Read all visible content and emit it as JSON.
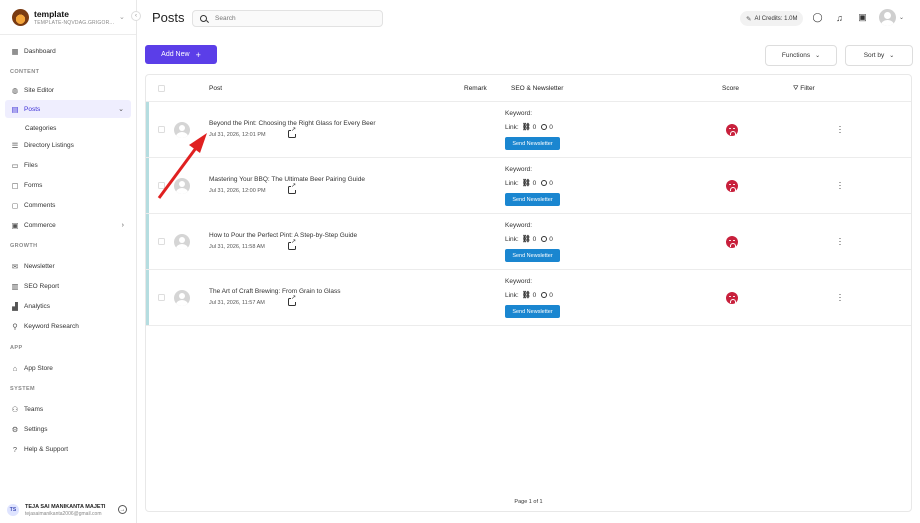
{
  "workspace": {
    "name": "template",
    "slug": "TEMPLATE-NQVDAG.GRIGOR...",
    "caret": "⌄"
  },
  "sidebar": {
    "collapse_glyph": "‹",
    "dashboard": "Dashboard",
    "content_label": "CONTENT",
    "site_editor": "Site Editor",
    "posts": "Posts",
    "categories": "Categories",
    "directory": "Directory Listings",
    "files": "Files",
    "forms": "Forms",
    "comments": "Comments",
    "commerce": "Commerce",
    "growth_label": "GROWTH",
    "newsletter": "Newsletter",
    "seo_report": "SEO Report",
    "analytics": "Analytics",
    "keyword_research": "Keyword Research",
    "app_label": "APP",
    "app_store": "App Store",
    "system_label": "SYSTEM",
    "teams": "Teams",
    "settings": "Settings",
    "help": "Help & Support",
    "chevron_down": "⌄",
    "chevron_right": "›"
  },
  "user": {
    "initials": "TS",
    "name": "TEJA SAI MANIKANTA MAJETI",
    "email": "tejasaimanikanta2006@gmail.com"
  },
  "header": {
    "title": "Posts",
    "search_placeholder": "Search",
    "credits": "AI Credits: 1.0M",
    "caret": "⌄"
  },
  "toolbar": {
    "add_new": "Add New",
    "add_plus": "+",
    "functions": "Functions",
    "sort_by": "Sort by",
    "caret": "⌄"
  },
  "table": {
    "columns": {
      "post": "Post",
      "remark": "Remark",
      "seo": "SEO & Newsletter",
      "score": "Score",
      "filter": "Filter"
    },
    "filter_glyph": "⛛",
    "keyword_label": "Keyword:",
    "link_label": "Link:",
    "send_label": "Send Newsletter",
    "rows": [
      {
        "title": "Beyond the Pint: Choosing the Right Glass for Every Beer",
        "date": "Jul 31, 2026, 12:01 PM",
        "links": "0",
        "time": "0"
      },
      {
        "title": "Mastering Your BBQ: The Ultimate Beer Pairing Guide",
        "date": "Jul 31, 2026, 12:00 PM",
        "links": "0",
        "time": "0"
      },
      {
        "title": "How to Pour the Perfect Pint: A Step-by-Step Guide",
        "date": "Jul 31, 2026, 11:58 AM",
        "links": "0",
        "time": "0"
      },
      {
        "title": "The Art of Craft Brewing: From Grain to Glass",
        "date": "Jul 31, 2026, 11:57 AM",
        "links": "0",
        "time": "0"
      }
    ],
    "pager": "Page 1 of 1"
  },
  "colors": {
    "accent": "#5b3ee8",
    "send": "#1a86d0",
    "score_bad": "#c8203c",
    "annotation": "#e02020"
  }
}
